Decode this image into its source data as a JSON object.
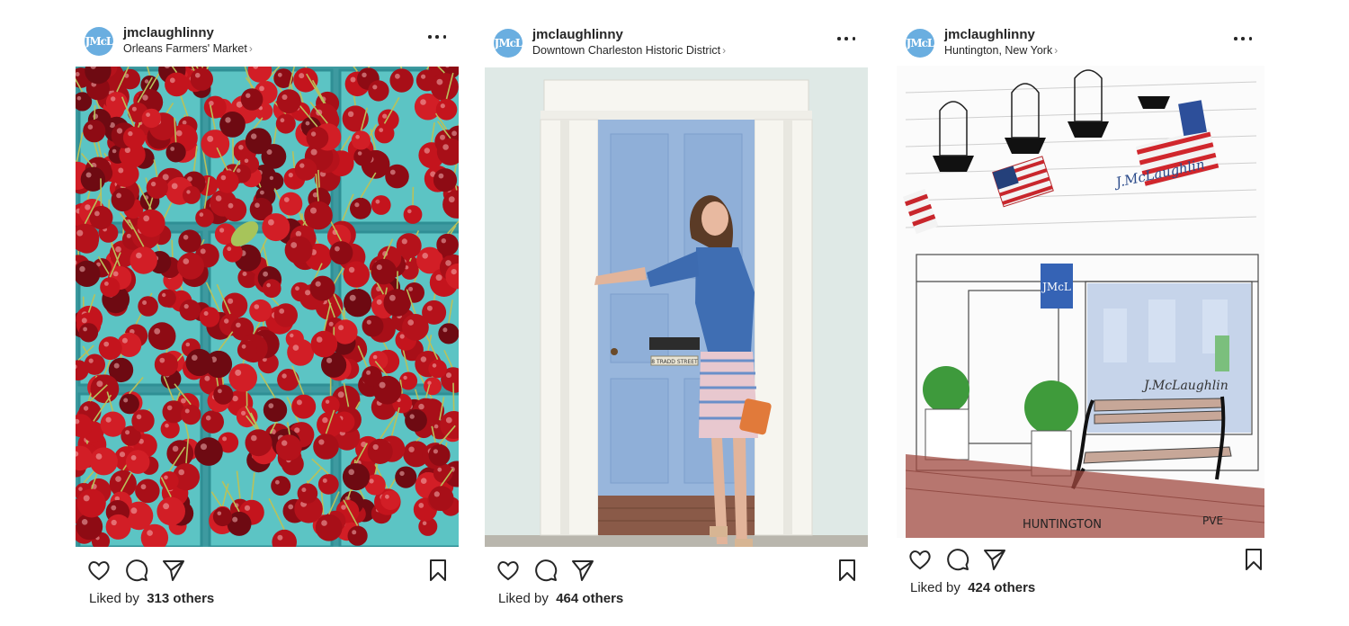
{
  "posts": [
    {
      "username": "jmclaughlinny",
      "location": "Orleans Farmers' Market",
      "avatar_text": "JMcL",
      "image_alt": "cherries",
      "likes_prefix": "Liked by",
      "likes_count": "313 others"
    },
    {
      "username": "jmclaughlinny",
      "location": "Downtown Charleston Historic District",
      "avatar_text": "JMcL",
      "image_alt": "blue door",
      "likes_prefix": "Liked by",
      "likes_count": "464 others",
      "door_plaque": "8 TRADD STREET"
    },
    {
      "username": "jmclaughlinny",
      "location": "Huntington, New York",
      "avatar_text": "JMcL",
      "image_alt": "storefront illustration",
      "likes_prefix": "Liked by",
      "likes_count": "424 others",
      "sign_text": "J.McLaughlin",
      "caption_text": "HUNTINGTON",
      "initials_text": "PVE"
    }
  ],
  "colors": {
    "avatar": "#6aaee0",
    "text": "#262626",
    "muted": "#8e8e8e"
  },
  "icons": [
    "heart-icon",
    "comment-icon",
    "share-icon",
    "bookmark-icon",
    "more-options-icon",
    "chevron-right-icon"
  ]
}
